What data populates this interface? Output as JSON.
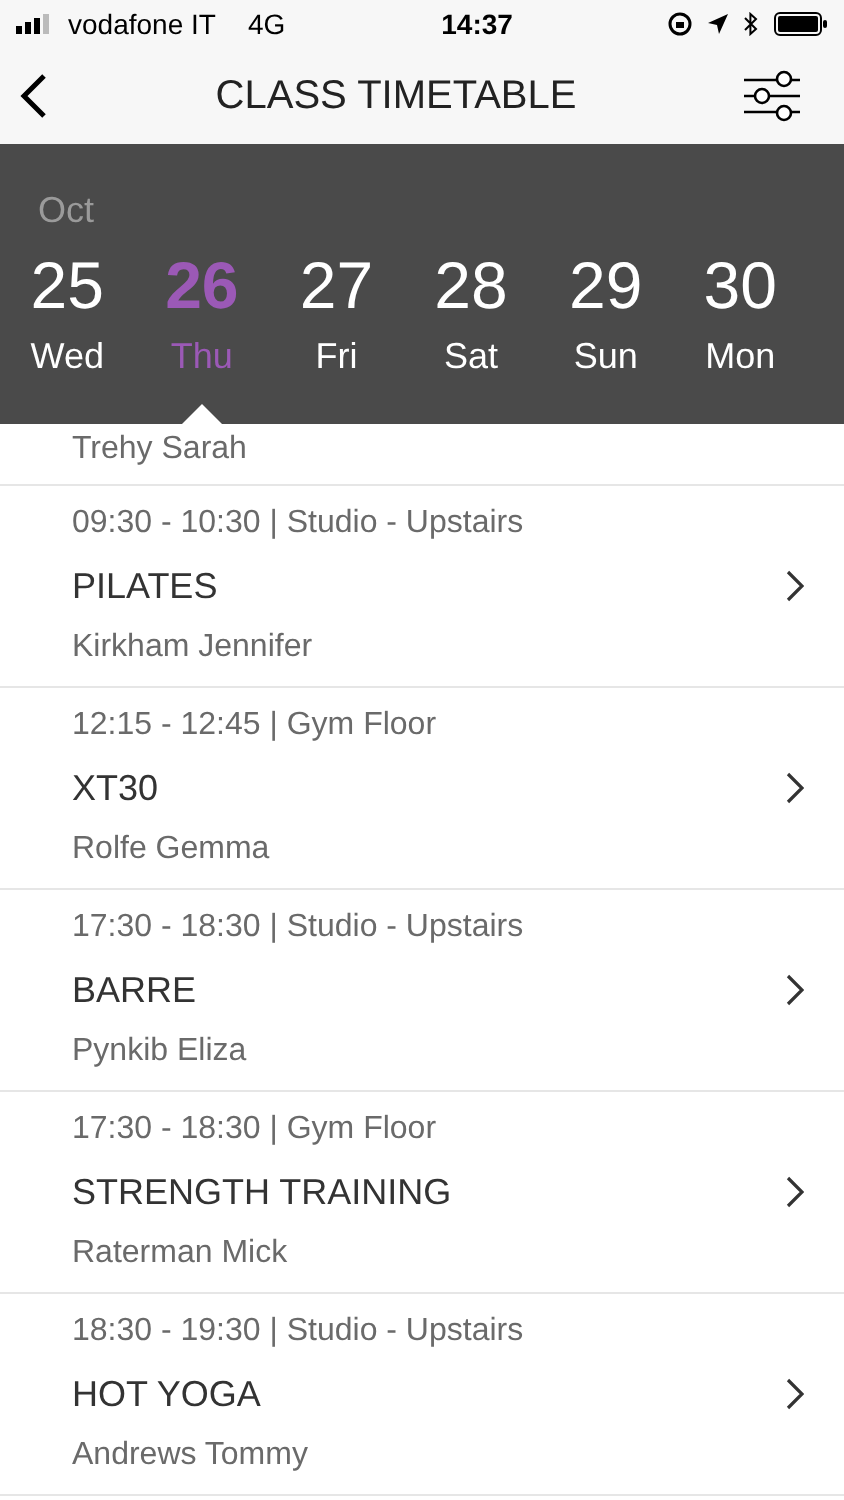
{
  "status_bar": {
    "carrier": "vodafone IT",
    "network": "4G",
    "time": "14:37"
  },
  "header": {
    "title": "CLASS TIMETABLE"
  },
  "calendar": {
    "month": "Oct",
    "days": [
      {
        "date": "25",
        "weekday": "Wed",
        "selected": false
      },
      {
        "date": "26",
        "weekday": "Thu",
        "selected": true
      },
      {
        "date": "27",
        "weekday": "Fri",
        "selected": false
      },
      {
        "date": "28",
        "weekday": "Sat",
        "selected": false
      },
      {
        "date": "29",
        "weekday": "Sun",
        "selected": false
      },
      {
        "date": "30",
        "weekday": "Mon",
        "selected": false
      }
    ]
  },
  "classes": [
    {
      "instructor": "Trehy Sarah"
    },
    {
      "time_location": "09:30 - 10:30 | Studio - Upstairs",
      "name": "PILATES",
      "instructor": "Kirkham Jennifer"
    },
    {
      "time_location": "12:15 - 12:45 | Gym Floor",
      "name": "XT30",
      "instructor": "Rolfe Gemma"
    },
    {
      "time_location": "17:30 - 18:30 | Studio - Upstairs",
      "name": "BARRE",
      "instructor": "Pynkib Eliza"
    },
    {
      "time_location": "17:30 - 18:30 | Gym Floor",
      "name": "STRENGTH TRAINING",
      "instructor": "Raterman Mick"
    },
    {
      "time_location": "18:30 - 19:30 | Studio - Upstairs",
      "name": "HOT YOGA",
      "instructor": "Andrews Tommy"
    }
  ]
}
